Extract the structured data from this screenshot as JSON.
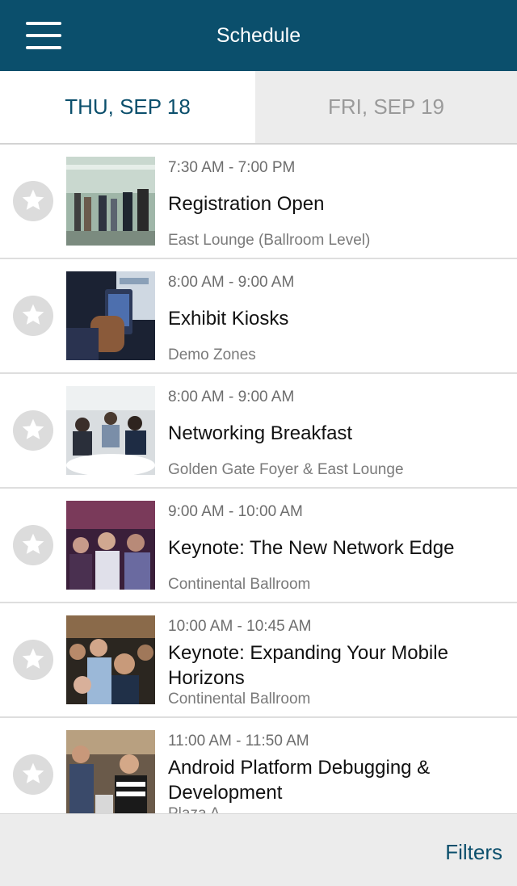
{
  "header": {
    "title": "Schedule",
    "menu_icon": "hamburger-menu-icon"
  },
  "tabs": [
    {
      "label": "THU, SEP 18",
      "active": true
    },
    {
      "label": "FRI, SEP 19",
      "active": false
    }
  ],
  "colors": {
    "brand": "#0b4f6c",
    "inactive_tab_bg": "#ececec",
    "star_bg": "#dcdcdc"
  },
  "sessions": [
    {
      "time": "7:30 AM - 7:00 PM",
      "title": "Registration Open",
      "location": "East Lounge (Ballroom Level)",
      "starred": false
    },
    {
      "time": "8:00 AM - 9:00 AM",
      "title": "Exhibit Kiosks",
      "location": "Demo Zones",
      "starred": false
    },
    {
      "time": "8:00 AM - 9:00 AM",
      "title": "Networking Breakfast",
      "location": "Golden Gate Foyer & East Lounge",
      "starred": false
    },
    {
      "time": "9:00 AM - 10:00 AM",
      "title": "Keynote: The New Network Edge",
      "location": "Continental Ballroom",
      "starred": false
    },
    {
      "time": "10:00 AM - 10:45 AM",
      "title": "Keynote: Expanding Your Mobile Horizons",
      "location": "Continental Ballroom",
      "starred": false
    },
    {
      "time": "11:00 AM - 11:50 AM",
      "title": "Android Platform Debugging & Development",
      "location": "Plaza A",
      "starred": false
    }
  ],
  "footer": {
    "filters_label": "Filters"
  }
}
